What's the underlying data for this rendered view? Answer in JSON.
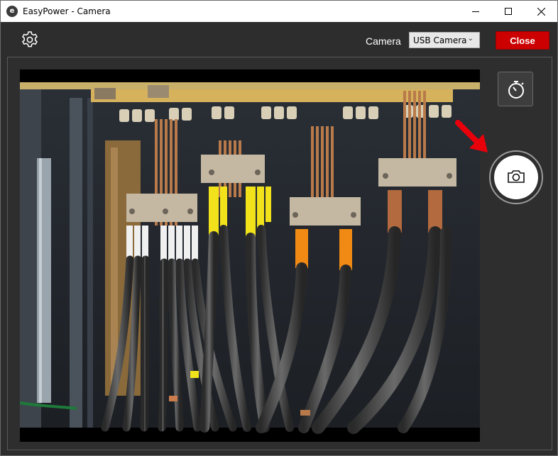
{
  "window": {
    "title": "EasyPower - Camera",
    "app_icon_letter": "e"
  },
  "toolbar": {
    "settings_icon": "gear-icon",
    "camera_label": "Camera",
    "camera_selected": "USB Camera",
    "close_label": "Close"
  },
  "preview": {
    "subject": "electrical-cabinet-cable-terminations-photo"
  },
  "controls": {
    "timer_icon": "stopwatch-icon",
    "capture_icon": "camera-icon"
  },
  "colors": {
    "close_button": "#cc0000",
    "background": "#2d2d2d",
    "annotation_arrow": "#e8000b"
  }
}
